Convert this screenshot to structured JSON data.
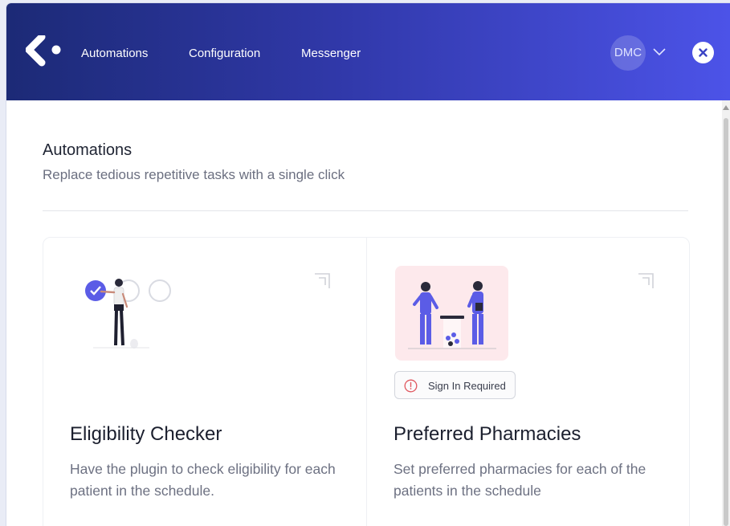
{
  "nav": {
    "items": [
      {
        "label": "Automations"
      },
      {
        "label": "Configuration"
      },
      {
        "label": "Messenger"
      }
    ],
    "user": {
      "initials": "DMC"
    },
    "icons": {
      "logo": "app-logo",
      "user_menu": "chevron-down-icon",
      "close": "close-icon"
    }
  },
  "page": {
    "title": "Automations",
    "subtitle": "Replace tedious repetitive tasks with a single click"
  },
  "cards": [
    {
      "title": "Eligibility Checker",
      "description": "Have the plugin to check eligibility for each patient in the schedule.",
      "illustration": "checklist-person-illustration",
      "action_icon": "expand-icon"
    },
    {
      "title": "Preferred Pharmacies",
      "description": "Set preferred pharmacies for each of the patients in the schedule",
      "illustration": "pharmacists-illustration",
      "action_icon": "expand-icon",
      "badge": {
        "label": "Sign In Required",
        "icon": "alert-circle-icon"
      }
    }
  ],
  "colors": {
    "header_start": "#1c2a76",
    "header_end": "#4c53e8",
    "accent": "#5b5ce6",
    "illustration_bg": "#fde9ec",
    "warning": "#e0575f"
  }
}
